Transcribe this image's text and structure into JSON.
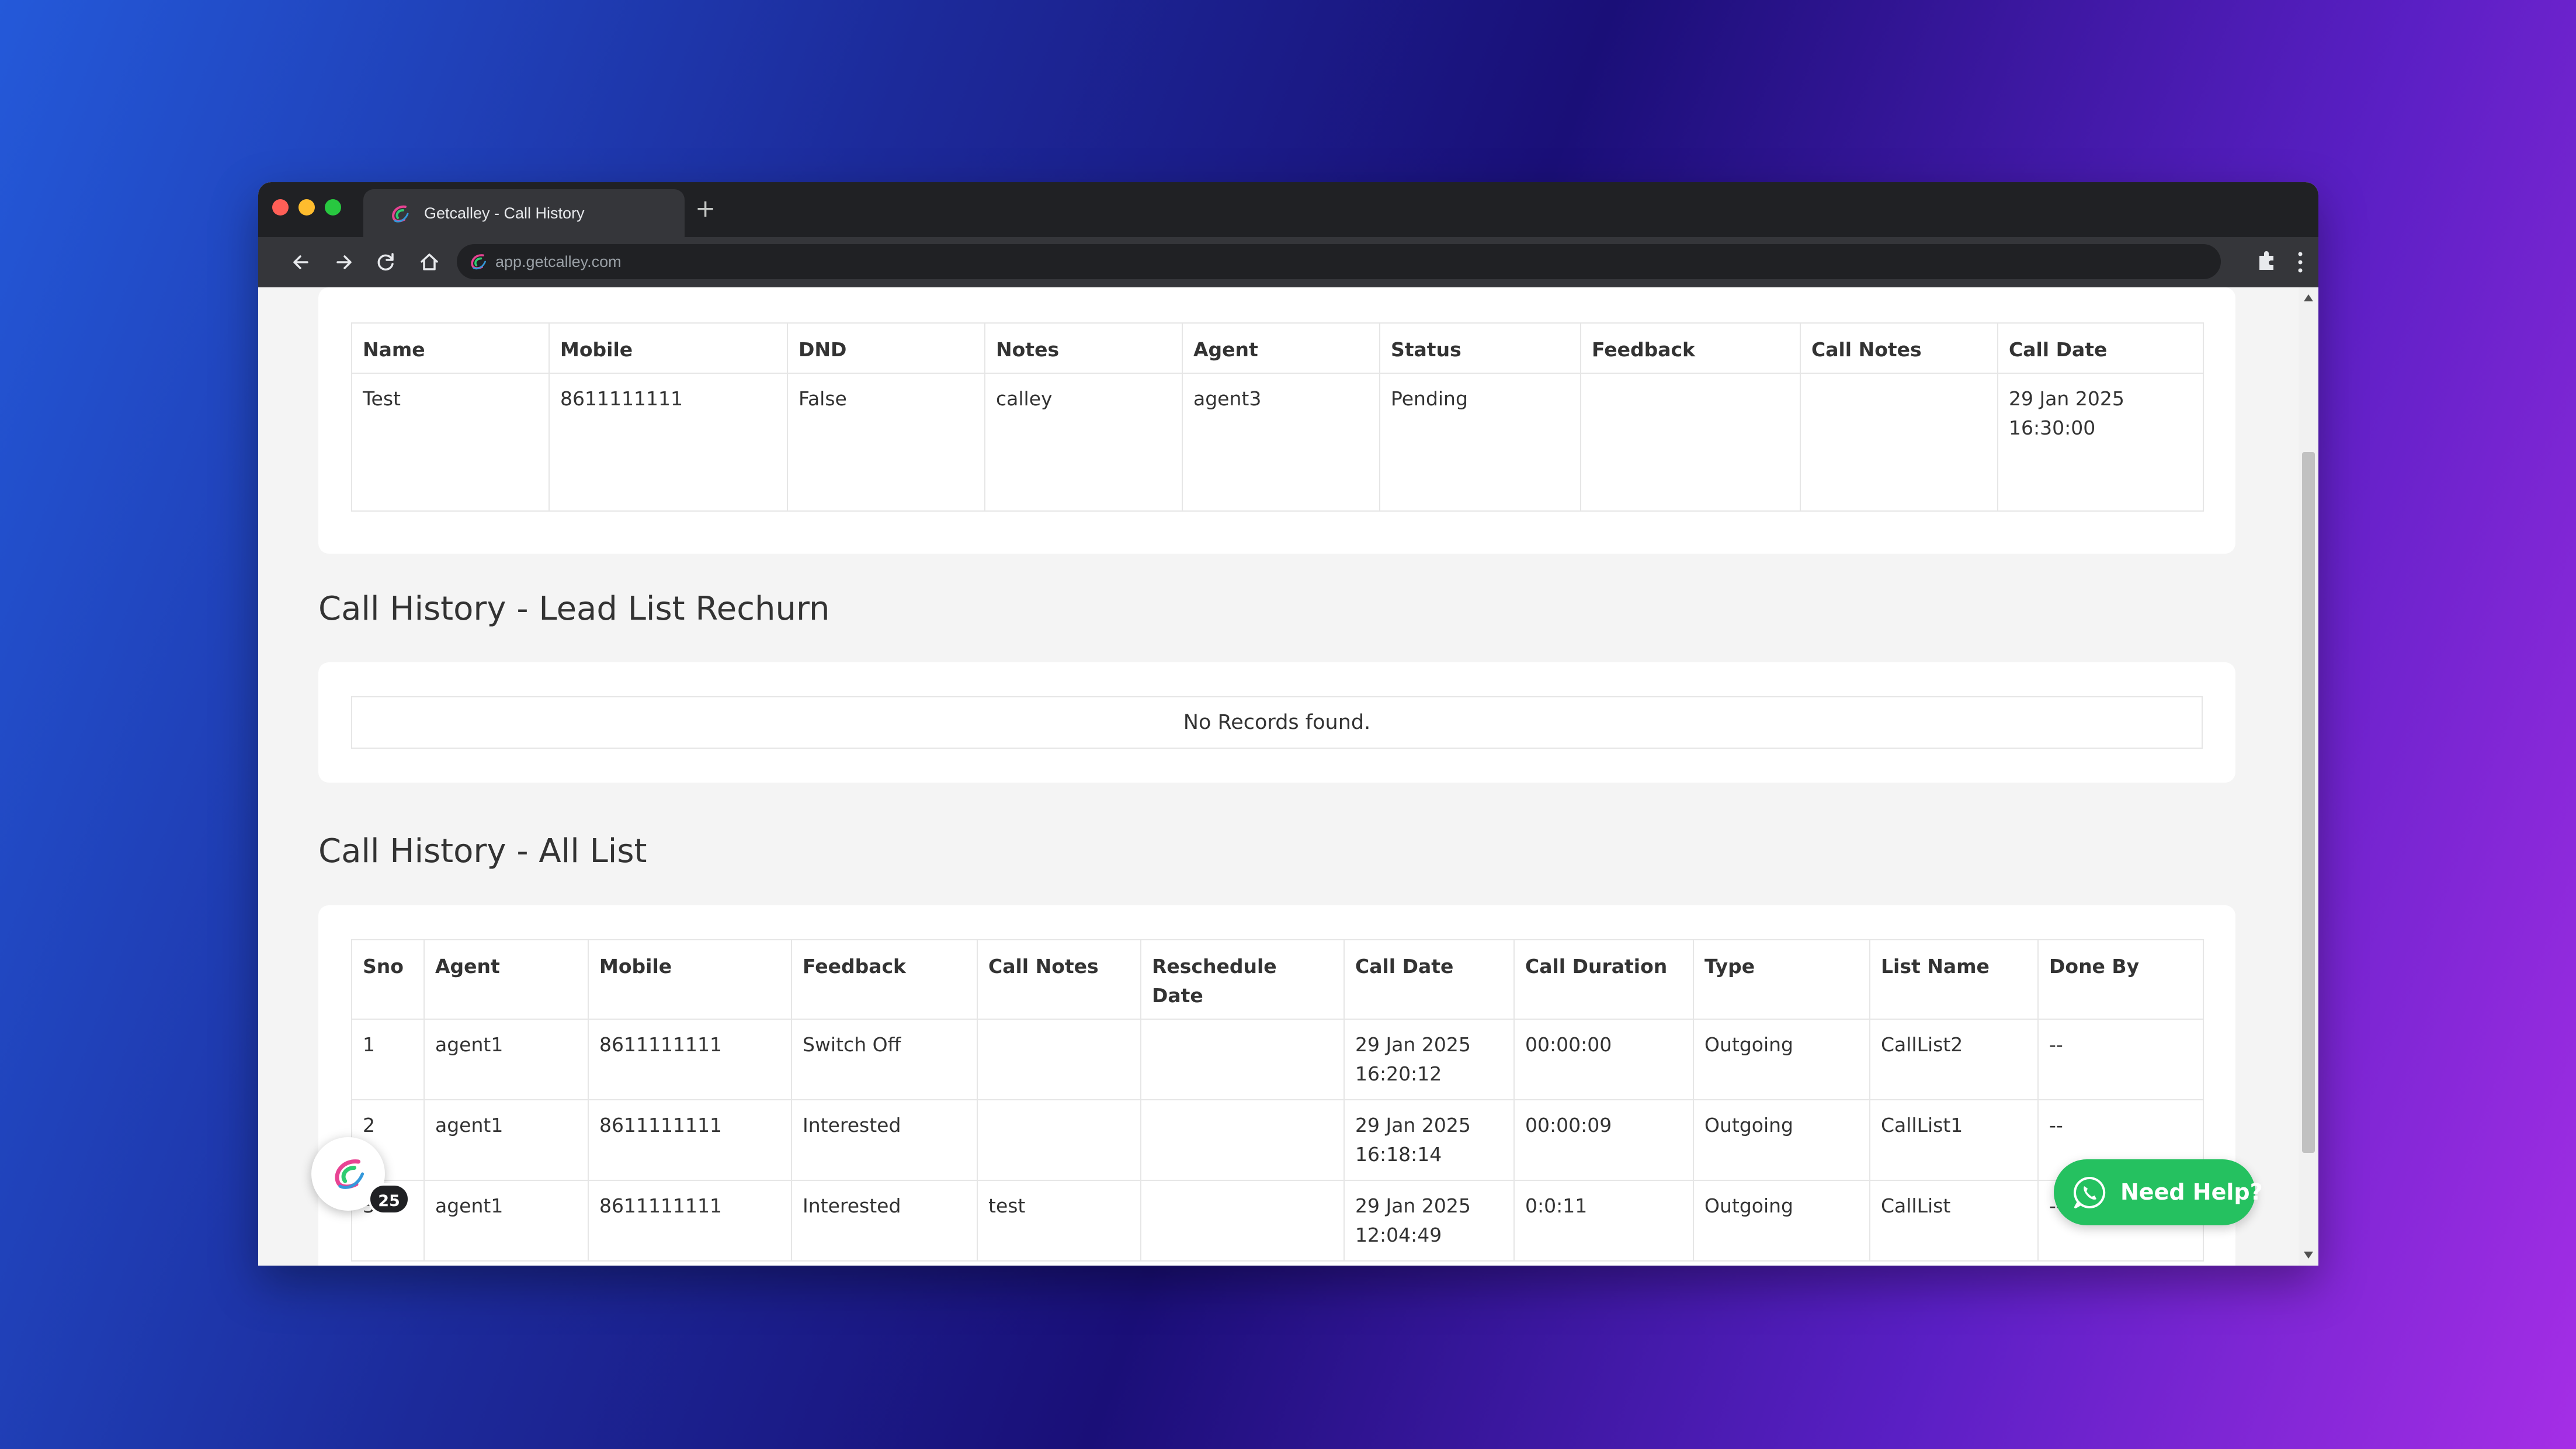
{
  "browser": {
    "tab_title": "Getcalley - Call History",
    "new_tab_label": "+",
    "url": "app.getcalley.com"
  },
  "lead_table": {
    "columns": [
      "Name",
      "Mobile",
      "DND",
      "Notes",
      "Agent",
      "Status",
      "Feedback",
      "Call Notes",
      "Call Date"
    ],
    "rows": [
      [
        "Test",
        "8611111111",
        "False",
        "calley",
        "agent3",
        "Pending",
        "",
        "",
        "29 Jan 2025 16:30:00"
      ]
    ]
  },
  "rechurn_section": {
    "title": "Call History - Lead List Rechurn",
    "empty_message": "No Records found."
  },
  "all_list_section": {
    "title": "Call History - All List",
    "columns": [
      "Sno",
      "Agent",
      "Mobile",
      "Feedback",
      "Call Notes",
      "Reschedule Date",
      "Call Date",
      "Call Duration",
      "Type",
      "List Name",
      "Done By"
    ],
    "rows": [
      [
        "1",
        "agent1",
        "8611111111",
        "Switch Off",
        "",
        "",
        "29 Jan 2025 16:20:12",
        "00:00:00",
        "Outgoing",
        "CallList2",
        "--"
      ],
      [
        "2",
        "agent1",
        "8611111111",
        "Interested",
        "",
        "",
        "29 Jan 2025 16:18:14",
        "00:00:09",
        "Outgoing",
        "CallList1",
        "--"
      ],
      [
        "3",
        "agent1",
        "8611111111",
        "Interested",
        "test",
        "",
        "29 Jan 2025 12:04:49",
        "0:0:11",
        "Outgoing",
        "CallList",
        "--"
      ]
    ]
  },
  "widgets": {
    "notification_count": "25",
    "help_label": "Need Help?"
  },
  "colors": {
    "help_button": "#25c160",
    "chrome_dark": "#202124",
    "page_bg": "#f4f4f4"
  },
  "icons": [
    "calley-logo-icon",
    "back-arrow-icon",
    "forward-arrow-icon",
    "reload-icon",
    "home-icon",
    "star-icon",
    "extensions-icon",
    "menu-icon",
    "whatsapp-icon"
  ]
}
